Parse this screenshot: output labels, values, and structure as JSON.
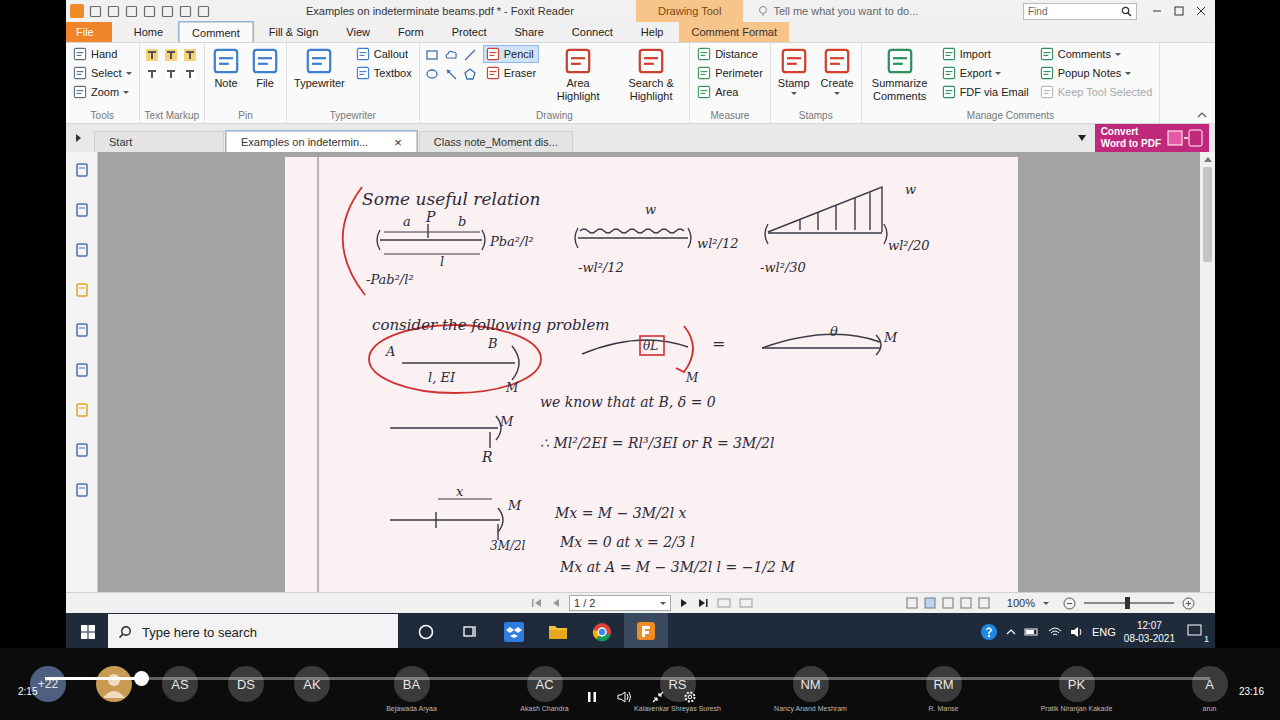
{
  "window": {
    "title": "Examples on indeterminate beams.pdf * - Foxit Reader",
    "context_tab": "Drawing Tool",
    "tell_me": "Tell me what you want to do...",
    "find": "Find"
  },
  "ribbon_tabs": [
    {
      "label": "File",
      "kind": "file",
      "selected": false
    },
    {
      "label": "Home",
      "kind": "tab",
      "selected": false
    },
    {
      "label": "Comment",
      "kind": "tab",
      "selected": true
    },
    {
      "label": "Fill & Sign",
      "kind": "tab",
      "selected": false
    },
    {
      "label": "View",
      "kind": "tab",
      "selected": false
    },
    {
      "label": "Form",
      "kind": "tab",
      "selected": false
    },
    {
      "label": "Protect",
      "kind": "tab",
      "selected": false
    },
    {
      "label": "Share",
      "kind": "tab",
      "selected": false
    },
    {
      "label": "Connect",
      "kind": "tab",
      "selected": false
    },
    {
      "label": "Help",
      "kind": "tab",
      "selected": false
    },
    {
      "label": "Comment Format",
      "kind": "context",
      "selected": false
    }
  ],
  "ribbon": [
    {
      "label": "Tools",
      "columns": [
        {
          "kind": "stack",
          "items": [
            {
              "label": "Hand",
              "selected": false,
              "menu": false,
              "disabled": false
            },
            {
              "label": "Select",
              "selected": false,
              "menu": true,
              "disabled": false
            },
            {
              "label": "Zoom",
              "selected": false,
              "menu": true,
              "disabled": false
            }
          ]
        }
      ]
    },
    {
      "label": "Text Markup",
      "columns": [
        {
          "kind": "markup",
          "items": []
        }
      ]
    },
    {
      "label": "Pin",
      "columns": [
        {
          "kind": "large",
          "items": [
            {
              "label": "Note",
              "selected": false,
              "menu": false,
              "disabled": false
            }
          ]
        },
        {
          "kind": "large",
          "items": [
            {
              "label": "File",
              "selected": false,
              "menu": false,
              "disabled": false
            }
          ]
        }
      ]
    },
    {
      "label": "Typewriter",
      "columns": [
        {
          "kind": "large",
          "items": [
            {
              "label": "Typewriter",
              "selected": false,
              "menu": false,
              "disabled": false
            }
          ]
        },
        {
          "kind": "stack",
          "items": [
            {
              "label": "Callout",
              "selected": false,
              "menu": false,
              "disabled": false
            },
            {
              "label": "Textbox",
              "selected": false,
              "menu": false,
              "disabled": false
            }
          ]
        }
      ]
    },
    {
      "label": "Drawing",
      "columns": [
        {
          "kind": "shapes",
          "items": []
        },
        {
          "kind": "stack",
          "items": [
            {
              "label": "Pencil",
              "selected": true,
              "menu": false,
              "disabled": false
            },
            {
              "label": "Eraser",
              "selected": false,
              "menu": false,
              "disabled": false
            }
          ]
        },
        {
          "kind": "large",
          "items": [
            {
              "label": "Area Highlight",
              "selected": false,
              "menu": false,
              "disabled": false
            }
          ]
        },
        {
          "kind": "large",
          "items": [
            {
              "label": "Search & Highlight",
              "selected": false,
              "menu": false,
              "disabled": false
            }
          ]
        }
      ]
    },
    {
      "label": "Measure",
      "columns": [
        {
          "kind": "stack",
          "items": [
            {
              "label": "Distance",
              "selected": false,
              "menu": false,
              "disabled": false
            },
            {
              "label": "Perimeter",
              "selected": false,
              "menu": false,
              "disabled": false
            },
            {
              "label": "Area",
              "selected": false,
              "menu": false,
              "disabled": false
            }
          ]
        }
      ]
    },
    {
      "label": "Stamps",
      "columns": [
        {
          "kind": "large",
          "items": [
            {
              "label": "Stamp",
              "selected": false,
              "menu": true,
              "disabled": false
            }
          ]
        },
        {
          "kind": "large",
          "items": [
            {
              "label": "Create",
              "selected": false,
              "menu": true,
              "disabled": false
            }
          ]
        }
      ]
    },
    {
      "label": "Manage Comments",
      "columns": [
        {
          "kind": "large",
          "items": [
            {
              "label": "Summarize Comments",
              "selected": false,
              "menu": false,
              "disabled": false
            }
          ]
        },
        {
          "kind": "stack",
          "items": [
            {
              "label": "Import",
              "selected": false,
              "menu": false,
              "disabled": false
            },
            {
              "label": "Export",
              "selected": false,
              "menu": true,
              "disabled": false
            },
            {
              "label": "FDF via Email",
              "selected": false,
              "menu": false,
              "disabled": false
            }
          ]
        },
        {
          "kind": "stack",
          "items": [
            {
              "label": "Comments",
              "selected": false,
              "menu": true,
              "disabled": false
            },
            {
              "label": "Popup Notes",
              "selected": false,
              "menu": true,
              "disabled": false
            },
            {
              "label": "Keep Tool Selected",
              "selected": false,
              "menu": false,
              "disabled": true
            }
          ]
        }
      ]
    }
  ],
  "doc_tabs": [
    {
      "label": "Start",
      "selected": false
    },
    {
      "label": "Examples on indetermin...",
      "selected": true,
      "close": "×"
    },
    {
      "label": "Class note_Moment dis...",
      "selected": false
    }
  ],
  "convert_button": {
    "lines": [
      "Convert",
      "Word to PDF"
    ]
  },
  "page": {
    "scroll_level": 0,
    "notes": [
      "Some useful relation",
      "a",
      "P",
      "b",
      "l",
      "Pba²/l²",
      "-Pab²/l²",
      "w",
      "-wl²/12",
      "wl²/12",
      "w",
      "-wl²/30",
      "wl²/20",
      "consider the following problem",
      "A",
      "B",
      "l, EI",
      "M",
      "θL",
      "M",
      "=",
      "θ",
      "M",
      "M",
      "R",
      "we know that at B, δ = 0",
      "∴  Ml²/2EI = Rl³/3EI   or  R = 3M/2l",
      "x",
      "M",
      "3M/2l",
      "Mx = M − 3M/2l x",
      "Mx = 0  at  x = 2/3 l",
      "Mx at A = M − 3M/2l l = −1/2 M"
    ]
  },
  "status_bar": {
    "page": "1 / 2",
    "zoom": "100%",
    "zoom_level": 0.48
  },
  "taskbar": {
    "search_placeholder": "Type here to search",
    "apps": [
      {
        "kind": "cortana",
        "active": false
      },
      {
        "kind": "taskview",
        "active": false
      },
      {
        "kind": "dropbox",
        "active": false
      },
      {
        "kind": "explorer",
        "active": false
      },
      {
        "kind": "chrome",
        "active": false
      },
      {
        "kind": "foxit",
        "active": true
      }
    ],
    "language": "ENG",
    "time": "12:07",
    "date": "08-03-2021",
    "notifications": "1"
  },
  "player": {
    "elapsed": "2:15",
    "total": "23:16",
    "level": 0.082,
    "playing": true,
    "participants": [
      {
        "kind": "count",
        "initials": "+22"
      },
      {
        "kind": "photo"
      },
      {
        "kind": "initials",
        "initials": "AS"
      },
      {
        "kind": "initials",
        "initials": "DS"
      },
      {
        "kind": "initials",
        "initials": "AK"
      },
      {
        "kind": "initials",
        "initials": "BA",
        "name": "Bejawada Aryaa"
      },
      {
        "kind": "initials",
        "initials": "AC",
        "name": "Akash Chandra"
      },
      {
        "kind": "initials",
        "initials": "RS",
        "name": "Kalavenkar Shreyas Suresh"
      },
      {
        "kind": "initials",
        "initials": "NM",
        "name": "Nancy Anand Meshram"
      },
      {
        "kind": "initials",
        "initials": "RM",
        "name": "R. Manse"
      },
      {
        "kind": "initials",
        "initials": "PK",
        "name": "Pratik Niranjan Kakade"
      },
      {
        "kind": "initials",
        "initials": "A",
        "name": "arun"
      }
    ]
  }
}
